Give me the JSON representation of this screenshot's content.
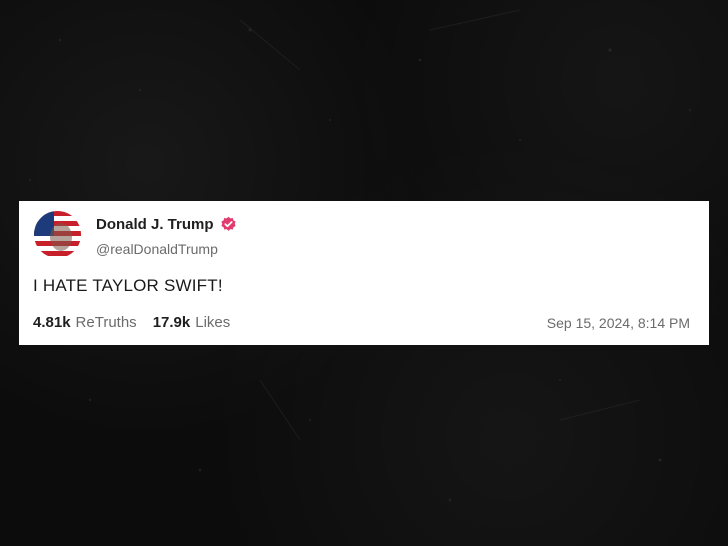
{
  "post": {
    "author_name": "Donald J. Trump",
    "author_handle": "@realDonaldTrump",
    "verified_icon": "verified-badge-icon",
    "verified_color": "#e23c6f",
    "text": "I HATE TAYLOR SWIFT!",
    "retruths_count": "4.81k",
    "retruths_label": "ReTruths",
    "likes_count": "17.9k",
    "likes_label": "Likes",
    "timestamp": "Sep 15, 2024, 8:14 PM"
  },
  "colors": {
    "background": "#0c0c0c",
    "card": "#ffffff",
    "flag_red": "#c8202a",
    "flag_blue": "#1d3b7a"
  }
}
